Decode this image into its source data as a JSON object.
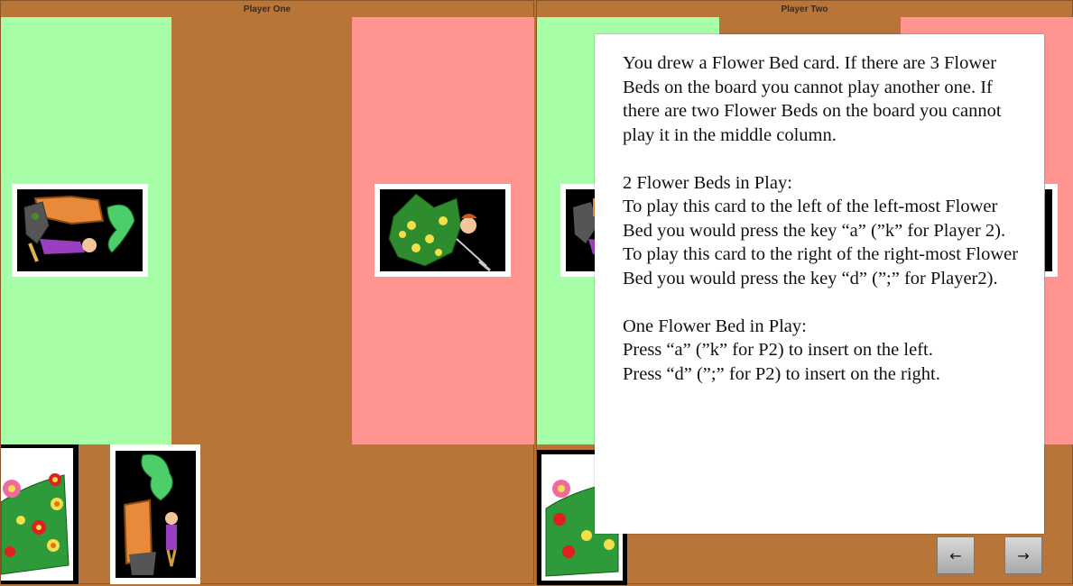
{
  "players": {
    "one": {
      "title": "Player One"
    },
    "two": {
      "title": "Player Two"
    }
  },
  "colors": {
    "board": "#b97438",
    "left_zone": "#a6ffa6",
    "right_zone": "#ff9490",
    "card_border": "#ffffff"
  },
  "instructions": {
    "paragraph1": "You drew a Flower Bed card. If there are 3 Flower Beds on the board you cannot play another one. If there are two Flower Beds on the board you cannot play it in the middle column.",
    "two_beds_heading": "2 Flower Beds in Play:",
    "two_beds_text": "To play this card to the left of the left-most Flower Bed you would press the key “a” (”k” for Player 2).  To play this card to the right of the right-most Flower Bed you would press the key “d” (”;” for Player2).",
    "one_bed_heading": "One Flower Bed in Play:",
    "one_bed_line1": "Press “a” (”k” for P2) to insert on the left.",
    "one_bed_line2": "Press “d” (”;” for P2) to insert on the right."
  },
  "navigation": {
    "prev_icon": "arrow-left-icon",
    "prev_glyph": "←",
    "next_icon": "arrow-right-icon",
    "next_glyph": "→"
  },
  "cards": {
    "p1_board_left": "carrot-gardener-card",
    "p1_board_right": "tree-gardener-card",
    "p1_hand_1": "flower-bed-card",
    "p1_hand_2": "carrot-gardener-card",
    "p2_board_left": "carrot-gardener-card",
    "p2_board_right": "tree-gardener-card",
    "p2_hand_1": "flower-bed-card"
  }
}
